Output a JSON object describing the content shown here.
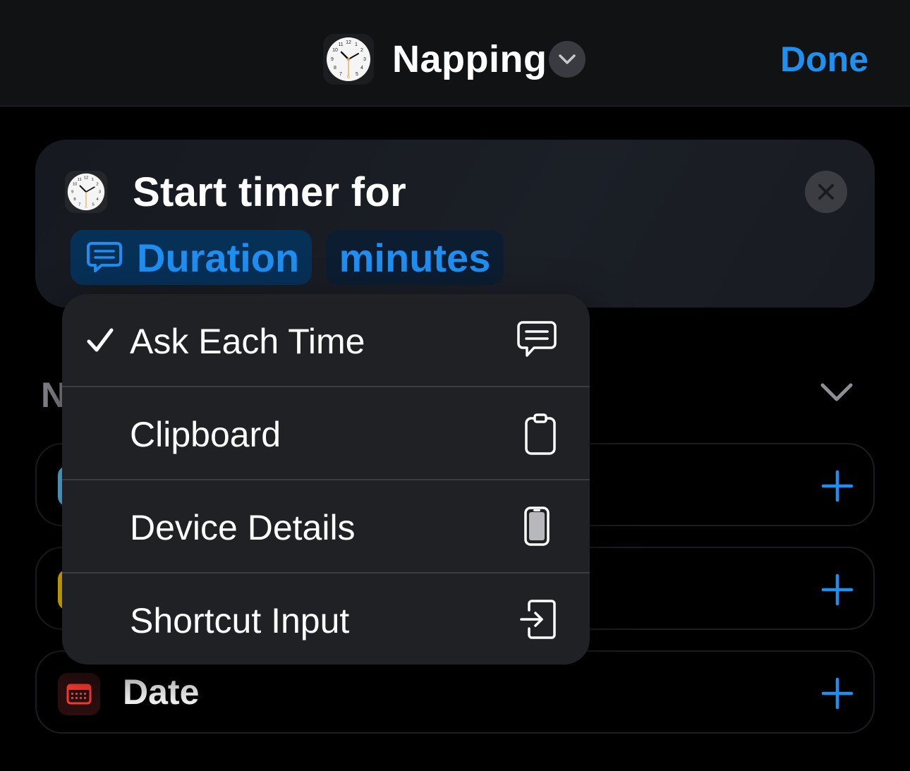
{
  "header": {
    "title": "Napping",
    "done_label": "Done",
    "app_icon": "clock-icon"
  },
  "action": {
    "title": "Start timer for",
    "duration_token": "Duration",
    "unit_token": "minutes",
    "token_icon": "speech-bubble-icon",
    "close_icon": "close-icon"
  },
  "menu": {
    "items": [
      {
        "label": "Ask Each Time",
        "icon": "speech-bubble-icon",
        "checked": true
      },
      {
        "label": "Clipboard",
        "icon": "clipboard-icon",
        "checked": false
      },
      {
        "label": "Device Details",
        "icon": "phone-icon",
        "checked": false
      },
      {
        "label": "Shortcut Input",
        "icon": "shortcut-input-icon",
        "checked": false
      }
    ]
  },
  "background": {
    "section_letter": "N",
    "rows": [
      {
        "label": "",
        "accent": "#5ac8fa"
      },
      {
        "label": "",
        "accent": "#ffcc00"
      },
      {
        "label": "Date",
        "icon": "calendar-icon"
      }
    ]
  },
  "colors": {
    "accent": "#1e90f0",
    "background": "#000000",
    "menu": "#1f2125"
  }
}
